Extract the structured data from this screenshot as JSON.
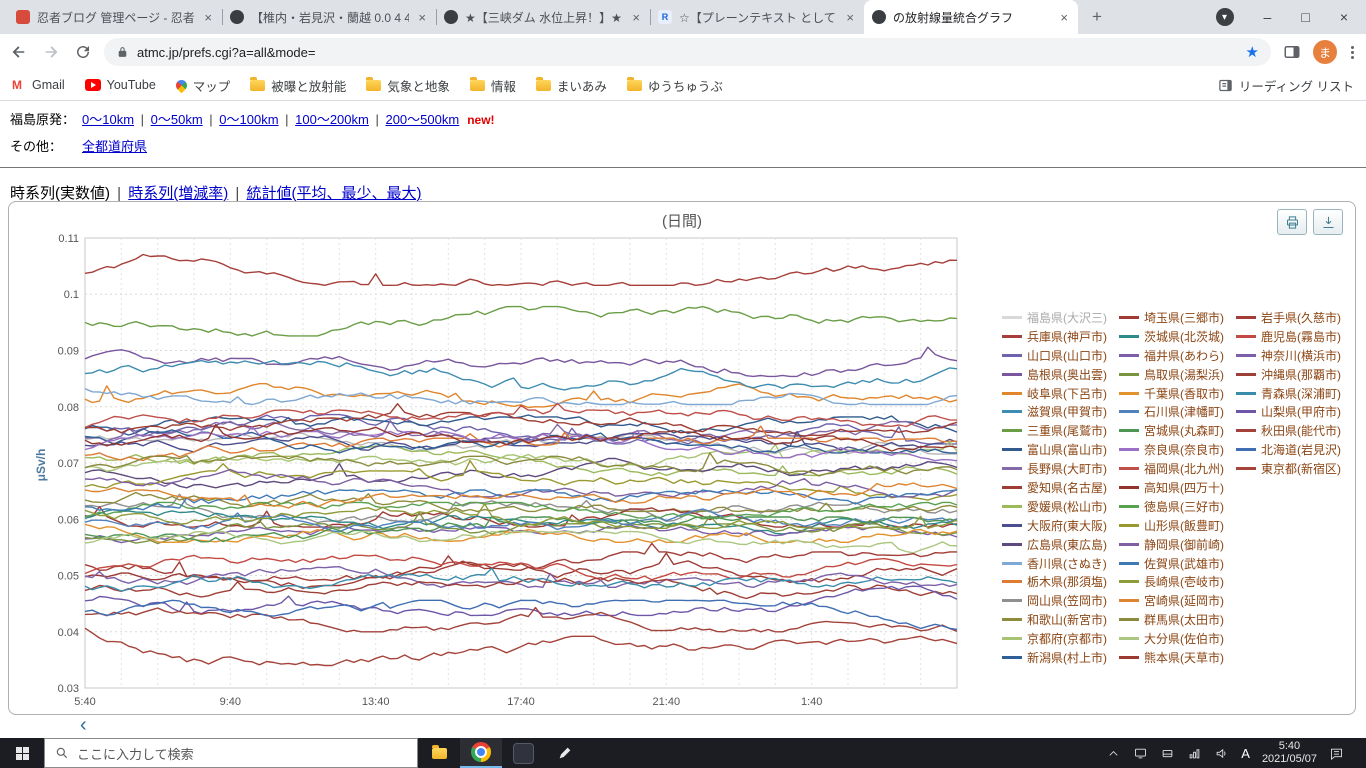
{
  "browser": {
    "tabs": [
      {
        "title": "忍者ブログ 管理ページ - 忍者ツ",
        "favicon": "red-square",
        "active": false
      },
      {
        "title": "【椎内・岩見沢・蘭越 0.0 4 4",
        "favicon": "dark-circle",
        "active": false
      },
      {
        "title": "★【三峡ダム 水位上昇！】★",
        "favicon": "dark-circle",
        "active": false
      },
      {
        "title": "☆【プレーンテキスト として 貼りつ",
        "favicon": "r-logo",
        "favicon_letter": "R",
        "active": false
      },
      {
        "title": "の放射線量統合グラフ",
        "favicon": "dark-circle",
        "active": true
      }
    ],
    "url": "atmc.jp/prefs.cgi?a=all&mode=",
    "avatar_letter": "ま",
    "bookmarks": [
      {
        "icon": "gmail",
        "label": "Gmail"
      },
      {
        "icon": "youtube",
        "label": "YouTube"
      },
      {
        "icon": "map",
        "label": "マップ"
      },
      {
        "icon": "folder",
        "label": "被曝と放射能"
      },
      {
        "icon": "folder",
        "label": "気象と地象"
      },
      {
        "icon": "folder",
        "label": "情報"
      },
      {
        "icon": "folder",
        "label": "まいあみ"
      },
      {
        "icon": "folder",
        "label": "ゆうちゅうぶ"
      }
    ],
    "reading_list": "リーディング リスト"
  },
  "page": {
    "row1_label": "福島原発：",
    "row1_links": [
      "0～10km",
      "0～50km",
      "0～100km",
      "100～200km",
      "200～500km"
    ],
    "row1_badge": "new!",
    "row2_label": "その他：",
    "row2_link": "全都道府県",
    "nav_current": "時系列(実数値)",
    "nav_links": [
      "時系列(増減率)",
      "統計値(平均、最少、最大)"
    ],
    "pager_prev": "‹"
  },
  "chart_data": {
    "type": "line",
    "title": "(日間)",
    "ylabel": "μSv/h",
    "ylim": [
      0.03,
      0.11
    ],
    "yticks": [
      "0.11",
      "0.1",
      "0.09",
      "0.08",
      "0.07",
      "0.06",
      "0.05",
      "0.04",
      "0.03"
    ],
    "xticks": [
      "5:40",
      "9:40",
      "13:40",
      "17:40",
      "21:40",
      "1:40"
    ],
    "x_span_hours": 24,
    "grid": true,
    "legend_position": "right",
    "legend_text_color": "#8b4513",
    "series": [
      {
        "name": "福島県(大沢三)",
        "color": "#b8b8b8",
        "base": 0.0742,
        "muted": true
      },
      {
        "name": "兵庫県(神戸市)",
        "color": "#a63f39",
        "base": 0.1042
      },
      {
        "name": "山口県(山口市)",
        "color": "#6f63ae",
        "base": 0.076
      },
      {
        "name": "島根県(奥出雲)",
        "color": "#7a569e",
        "base": 0.088
      },
      {
        "name": "岐阜県(下呂市)",
        "color": "#e0862c",
        "base": 0.0815
      },
      {
        "name": "滋賀県(甲賀市)",
        "color": "#3e8cb0",
        "base": 0.0856
      },
      {
        "name": "三重県(尾鷲市)",
        "color": "#6a9e46",
        "base": 0.0952
      },
      {
        "name": "富山県(富山市)",
        "color": "#315a8d",
        "base": 0.0756
      },
      {
        "name": "長野県(大町市)",
        "color": "#8468a8",
        "base": 0.0748
      },
      {
        "name": "愛知県(名古屋)",
        "color": "#9e3d33",
        "base": 0.0764
      },
      {
        "name": "愛媛県(松山市)",
        "color": "#9cba5c",
        "base": 0.0704
      },
      {
        "name": "大阪府(東大阪)",
        "color": "#4c4f8b",
        "base": 0.0726
      },
      {
        "name": "広島県(東広島)",
        "color": "#5f4a7d",
        "base": 0.0682
      },
      {
        "name": "香川県(さぬき)",
        "color": "#7fa8d2",
        "base": 0.083
      },
      {
        "name": "栃木県(那須塩)",
        "color": "#de7b35",
        "base": 0.0718
      },
      {
        "name": "岡山県(笠岡市)",
        "color": "#8f8f8f",
        "base": 0.062
      },
      {
        "name": "和歌山(新宮市)",
        "color": "#8e8c3c",
        "base": 0.064
      },
      {
        "name": "京都府(京都市)",
        "color": "#a7c474",
        "base": 0.0698
      },
      {
        "name": "新潟県(村上市)",
        "color": "#2f5f96",
        "base": 0.0744
      },
      {
        "name": "埼玉県(三郷市)",
        "color": "#a03a35",
        "base": 0.0612
      },
      {
        "name": "茨城県(北茨城)",
        "color": "#2f8a8a",
        "base": 0.06
      },
      {
        "name": "福井県(あわら)",
        "color": "#7d5ea8",
        "base": 0.056
      },
      {
        "name": "鳥取県(湯梨浜)",
        "color": "#7a9440",
        "base": 0.0566
      },
      {
        "name": "千葉県(香取市)",
        "color": "#e2932d",
        "base": 0.0585
      },
      {
        "name": "石川県(津幡町)",
        "color": "#4f81bd",
        "base": 0.0592
      },
      {
        "name": "宮城県(丸森町)",
        "color": "#4f9553",
        "base": 0.0578
      },
      {
        "name": "奈良県(奈良市)",
        "color": "#9a6fc4",
        "base": 0.073
      },
      {
        "name": "福岡県(北九州)",
        "color": "#bf4f4a",
        "base": 0.0768
      },
      {
        "name": "高知県(四万十)",
        "color": "#93352f",
        "base": 0.0738
      },
      {
        "name": "徳島県(三好市)",
        "color": "#58a150",
        "base": 0.0604
      },
      {
        "name": "山形県(飯豊町)",
        "color": "#99992f",
        "base": 0.066
      },
      {
        "name": "静岡県(御前崎)",
        "color": "#7e5fa2",
        "base": 0.0666
      },
      {
        "name": "佐賀県(武雄市)",
        "color": "#3f7ab5",
        "base": 0.0626
      },
      {
        "name": "長崎県(壱岐市)",
        "color": "#8f9c3a",
        "base": 0.061
      },
      {
        "name": "宮崎県(延岡市)",
        "color": "#dc8430",
        "base": 0.0646
      },
      {
        "name": "群馬県(太田市)",
        "color": "#8b8b3e",
        "base": 0.0686
      },
      {
        "name": "大分県(佐伯市)",
        "color": "#aac680",
        "base": 0.0552
      },
      {
        "name": "熊本県(天草市)",
        "color": "#9c3a33",
        "base": 0.05
      },
      {
        "name": "岩手県(久慈市)",
        "color": "#a23d37",
        "base": 0.0516
      },
      {
        "name": "鹿児島(霧島市)",
        "color": "#c24a42",
        "base": 0.051
      },
      {
        "name": "神奈川(横浜市)",
        "color": "#7d61a8",
        "base": 0.0505
      },
      {
        "name": "沖縄県(那覇市)",
        "color": "#9e3f38",
        "base": 0.047
      },
      {
        "name": "青森県(深浦町)",
        "color": "#3a8cab",
        "base": 0.0476
      },
      {
        "name": "山梨県(甲府市)",
        "color": "#6e57a8",
        "base": 0.0455
      },
      {
        "name": "秋田県(能代市)",
        "color": "#a2423b",
        "base": 0.0426
      },
      {
        "name": "北海道(岩見沢)",
        "color": "#3f6eb2",
        "base": 0.043
      },
      {
        "name": "東京都(新宿区)",
        "color": "#a5443a",
        "base": 0.0366,
        "start": 0.0406
      }
    ]
  },
  "taskbar": {
    "search_placeholder": "ここに入力して検索",
    "ime_mode": "A",
    "time": "5:40",
    "date": "2021/05/07"
  }
}
